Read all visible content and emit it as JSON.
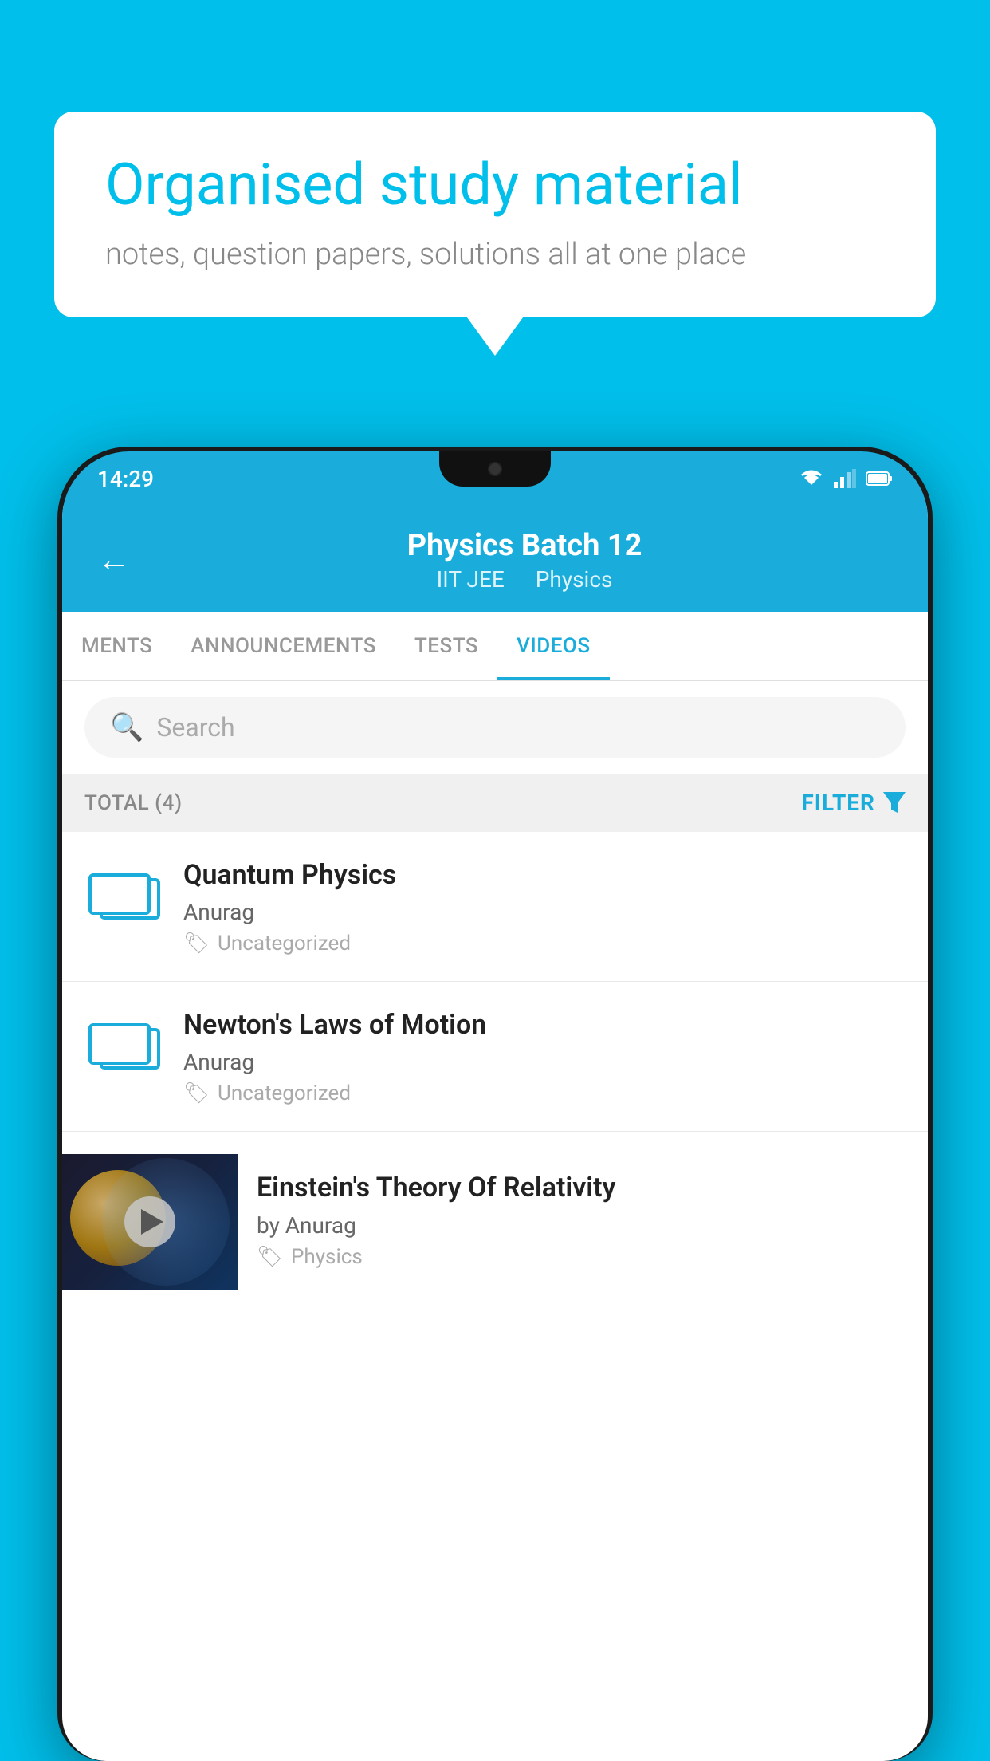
{
  "background": {
    "color": "#00BFEA"
  },
  "speech_bubble": {
    "headline": "Organised study material",
    "subtext": "notes, question papers, solutions all at one place"
  },
  "phone": {
    "status_bar": {
      "time": "14:29"
    },
    "header": {
      "back_label": "←",
      "title": "Physics Batch 12",
      "subtitle_part1": "IIT JEE",
      "subtitle_part2": "Physics"
    },
    "tabs": [
      {
        "label": "MENTS",
        "active": false
      },
      {
        "label": "ANNOUNCEMENTS",
        "active": false
      },
      {
        "label": "TESTS",
        "active": false
      },
      {
        "label": "VIDEOS",
        "active": true
      }
    ],
    "search": {
      "placeholder": "Search"
    },
    "filter_bar": {
      "total_label": "TOTAL (4)",
      "filter_label": "FILTER"
    },
    "videos": [
      {
        "id": 1,
        "title": "Quantum Physics",
        "author": "Anurag",
        "tag": "Uncategorized",
        "has_thumbnail": false
      },
      {
        "id": 2,
        "title": "Newton's Laws of Motion",
        "author": "Anurag",
        "tag": "Uncategorized",
        "has_thumbnail": false
      },
      {
        "id": 3,
        "title": "Einstein's Theory Of Relativity",
        "author": "by Anurag",
        "tag": "Physics",
        "has_thumbnail": true
      }
    ]
  }
}
